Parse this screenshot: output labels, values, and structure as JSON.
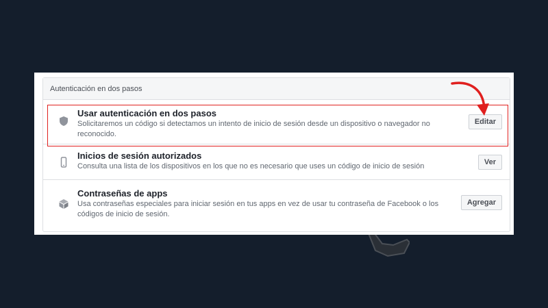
{
  "section": {
    "header": "Autenticación en dos pasos"
  },
  "rows": [
    {
      "title": "Usar autenticación en dos pasos",
      "description": "Solicitaremos un código si detectamos un intento de inicio de sesión desde un dispositivo o navegador no reconocido.",
      "button": "Editar",
      "icon": "shield-icon"
    },
    {
      "title": "Inicios de sesión autorizados",
      "description": "Consulta una lista de los dispositivos en los que no es necesario que uses un código de inicio de sesión",
      "button": "Ver",
      "icon": "phone-icon"
    },
    {
      "title": "Contraseñas de apps",
      "description": "Usa contraseñas especiales para iniciar sesión en tus apps en vez de usar tu contraseña de Facebook o los códigos de inicio de sesión.",
      "button": "Agregar",
      "icon": "cube-icon"
    }
  ],
  "colors": {
    "background": "#141e2c",
    "highlight": "#e0201f",
    "arrow": "#e0201f"
  }
}
